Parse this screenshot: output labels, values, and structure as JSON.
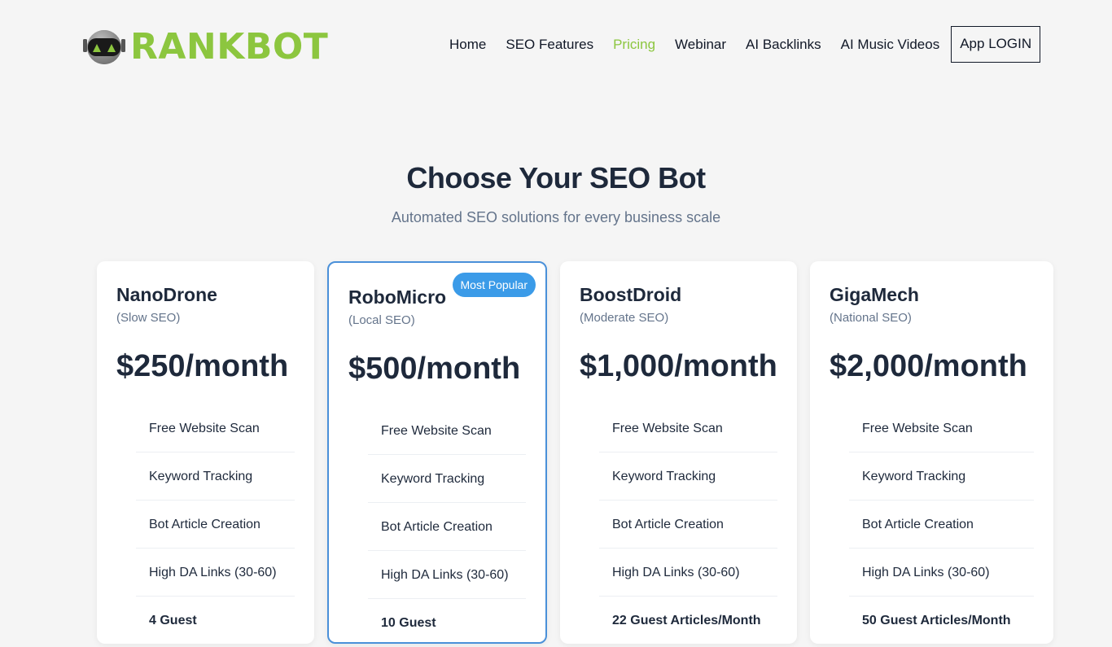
{
  "brand": {
    "name": "RANKBOT",
    "color": "#8cc63f",
    "icon": "robot-head-icon"
  },
  "nav": {
    "items": [
      {
        "label": "Home",
        "active": false
      },
      {
        "label": "SEO Features",
        "active": false
      },
      {
        "label": "Pricing",
        "active": true
      },
      {
        "label": "Webinar",
        "active": false
      },
      {
        "label": "AI Backlinks",
        "active": false
      },
      {
        "label": "AI Music Videos",
        "active": false
      }
    ],
    "login_label": "App LOGIN"
  },
  "hero": {
    "title": "Choose Your SEO Bot",
    "subtitle": "Automated SEO solutions for every business scale"
  },
  "plans": [
    {
      "name": "NanoDrone",
      "type": "(Slow SEO)",
      "price": "$250/month",
      "features": [
        "Free Website Scan",
        "Keyword Tracking",
        "Bot Article Creation",
        "High DA Links (30-60)",
        "4 Guest"
      ]
    },
    {
      "name": "RoboMicro",
      "type": "(Local SEO)",
      "price": "$500/month",
      "badge": "Most Popular",
      "features": [
        "Free Website Scan",
        "Keyword Tracking",
        "Bot Article Creation",
        "High DA Links (30-60)",
        "10 Guest"
      ]
    },
    {
      "name": "BoostDroid",
      "type": "(Moderate SEO)",
      "price": "$1,000/month",
      "features": [
        "Free Website Scan",
        "Keyword Tracking",
        "Bot Article Creation",
        "High DA Links (30-60)",
        "22 Guest Articles/Month"
      ]
    },
    {
      "name": "GigaMech",
      "type": "(National SEO)",
      "price": "$2,000/month",
      "features": [
        "Free Website Scan",
        "Keyword Tracking",
        "Bot Article Creation",
        "High DA Links (30-60)",
        "50 Guest Articles/Month"
      ]
    }
  ],
  "colors": {
    "accent": "#8cc63f",
    "popular_border": "#4a90d9",
    "badge": "#3b9be8",
    "heading": "#1e293b",
    "muted": "#64748b"
  }
}
